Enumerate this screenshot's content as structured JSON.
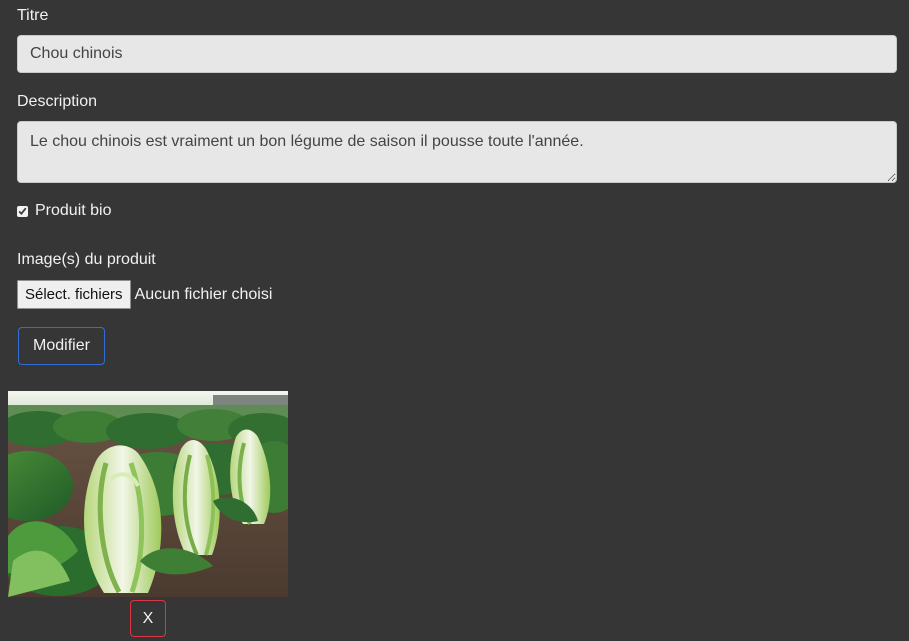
{
  "form": {
    "title_label": "Titre",
    "title_value": "Chou chinois",
    "description_label": "Description",
    "description_value": "Le chou chinois est vraiment un bon légume de saison il pousse toute l'année.",
    "organic_checkbox_label": "Produit bio",
    "organic_checked": true,
    "images_label": "Image(s) du produit",
    "file_button_label": "Sélect. fichiers",
    "file_status": "Aucun fichier choisi",
    "submit_label": "Modifier"
  },
  "product_image": {
    "subject": "chinese-cabbage-field"
  },
  "image_actions": {
    "delete_label": "X"
  },
  "colors": {
    "background": "#363636",
    "input_background": "#e7e7e7",
    "primary_border": "#2f6fd1",
    "danger_border": "#dc3545"
  }
}
